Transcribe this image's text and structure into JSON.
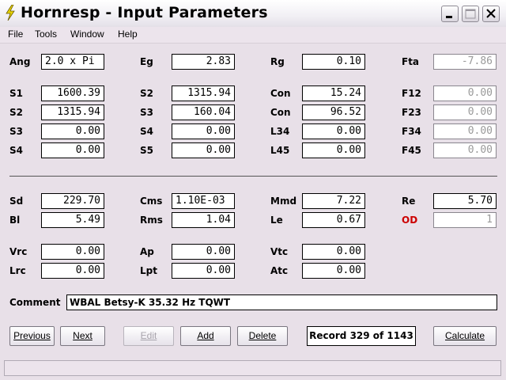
{
  "window": {
    "title": "Hornresp - Input Parameters"
  },
  "menu": {
    "items": [
      "File",
      "Tools",
      "Window",
      "Help"
    ]
  },
  "params": {
    "ang": {
      "label": "Ang",
      "value": "2.0 x Pi"
    },
    "eg": {
      "label": "Eg",
      "value": "2.83"
    },
    "rg": {
      "label": "Rg",
      "value": "0.10"
    },
    "fta": {
      "label": "Fta",
      "value": "-7.86"
    },
    "s1": {
      "label": "S1",
      "value": "1600.39"
    },
    "s2a": {
      "label": "S2",
      "value": "1315.94"
    },
    "con1": {
      "label": "Con",
      "value": "15.24"
    },
    "f12": {
      "label": "F12",
      "value": "0.00"
    },
    "s2b": {
      "label": "S2",
      "value": "1315.94"
    },
    "s3a": {
      "label": "S3",
      "value": "160.04"
    },
    "con2": {
      "label": "Con",
      "value": "96.52"
    },
    "f23": {
      "label": "F23",
      "value": "0.00"
    },
    "s3b": {
      "label": "S3",
      "value": "0.00"
    },
    "s4a": {
      "label": "S4",
      "value": "0.00"
    },
    "l34": {
      "label": "L34",
      "value": "0.00"
    },
    "f34": {
      "label": "F34",
      "value": "0.00"
    },
    "s4b": {
      "label": "S4",
      "value": "0.00"
    },
    "s5": {
      "label": "S5",
      "value": "0.00"
    },
    "l45": {
      "label": "L45",
      "value": "0.00"
    },
    "f45": {
      "label": "F45",
      "value": "0.00"
    },
    "sd": {
      "label": "Sd",
      "value": "229.70"
    },
    "cms": {
      "label": "Cms",
      "value": "1.10E-03"
    },
    "mmd": {
      "label": "Mmd",
      "value": "7.22"
    },
    "re": {
      "label": "Re",
      "value": "5.70"
    },
    "bl": {
      "label": "Bl",
      "value": "5.49"
    },
    "rms": {
      "label": "Rms",
      "value": "1.04"
    },
    "le": {
      "label": "Le",
      "value": "0.67"
    },
    "od": {
      "label": "OD",
      "value": "1"
    },
    "vrc": {
      "label": "Vrc",
      "value": "0.00"
    },
    "ap": {
      "label": "Ap",
      "value": "0.00"
    },
    "vtc": {
      "label": "Vtc",
      "value": "0.00"
    },
    "lrc": {
      "label": "Lrc",
      "value": "0.00"
    },
    "lpt": {
      "label": "Lpt",
      "value": "0.00"
    },
    "atc": {
      "label": "Atc",
      "value": "0.00"
    }
  },
  "comment": {
    "label": "Comment",
    "value": "WBAL Betsy-K 35.32 Hz TQWT"
  },
  "buttons": {
    "previous": "Previous",
    "next": "Next",
    "edit": "Edit",
    "add": "Add",
    "delete": "Delete",
    "calculate": "Calculate"
  },
  "record": "Record 329 of 1143",
  "colors": {
    "od_label": "#cc0000"
  }
}
